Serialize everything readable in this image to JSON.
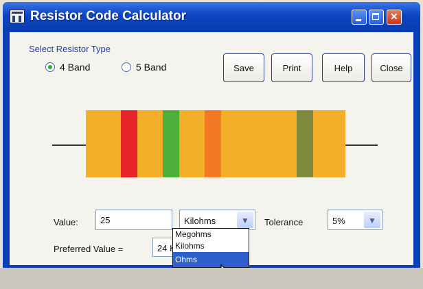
{
  "window": {
    "title": "Resistor Code Calculator"
  },
  "resistor_type": {
    "group_label": "Select Resistor Type",
    "options": [
      {
        "label": "4 Band",
        "selected": true
      },
      {
        "label": "5 Band",
        "selected": false
      }
    ]
  },
  "buttons": {
    "save": "Save",
    "print": "Print",
    "help": "Help",
    "close": "Close"
  },
  "resistor": {
    "body_color": "#f3af2a",
    "bands": [
      "#e8262a",
      "#4caf3a",
      "#f37a22",
      "#7f8a3c"
    ]
  },
  "form": {
    "value_label": "Value:",
    "value": "25",
    "unit_selected": "Kilohms",
    "tolerance_label": "Tolerance",
    "tolerance_selected": "5%",
    "preferred_label": "Preferred Value =",
    "preferred_value": "24 K"
  },
  "unit_dropdown": {
    "options": [
      "Megohms",
      "Kilohms",
      "Ohms"
    ],
    "highlighted": "Ohms"
  }
}
